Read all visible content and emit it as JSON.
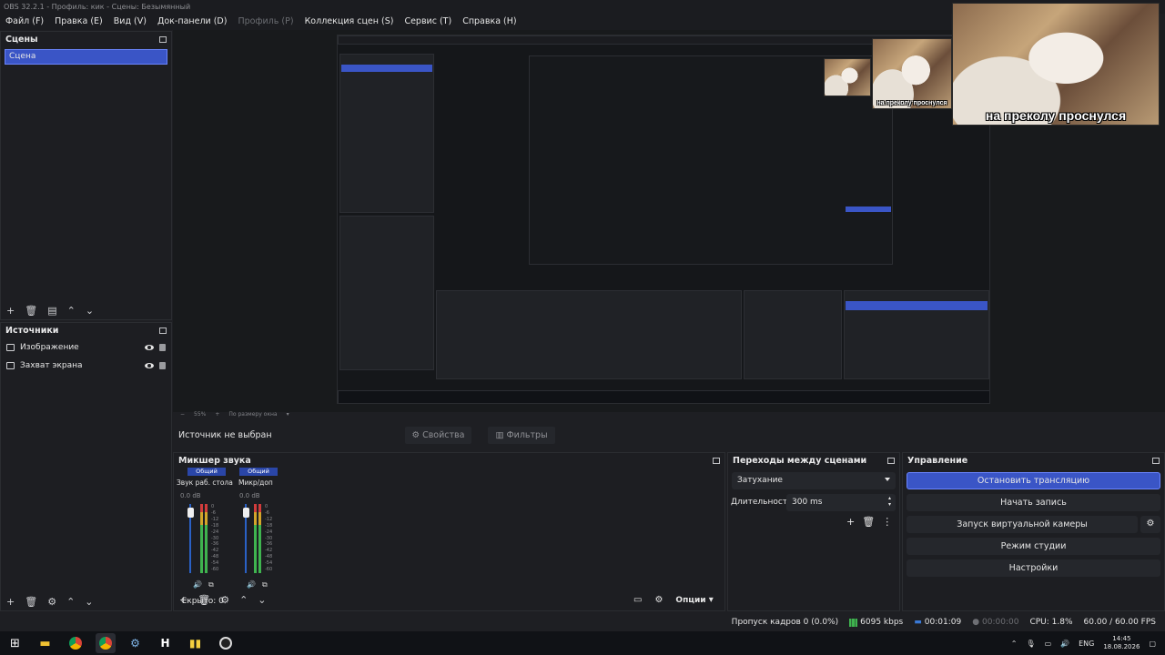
{
  "window": {
    "title": "OBS 32.2.1 - Профиль: кик - Сцены: Безымянный"
  },
  "menu": [
    {
      "label": "Файл (F)",
      "enabled": true
    },
    {
      "label": "Правка (E)",
      "enabled": true
    },
    {
      "label": "Вид (V)",
      "enabled": true
    },
    {
      "label": "Док-панели (D)",
      "enabled": true
    },
    {
      "label": "Профиль (P)",
      "enabled": false
    },
    {
      "label": "Коллекция сцен (S)",
      "enabled": true
    },
    {
      "label": "Сервис (T)",
      "enabled": true
    },
    {
      "label": "Справка (H)",
      "enabled": true
    }
  ],
  "scenes": {
    "title": "Сцены",
    "items": [
      "Сцена"
    ]
  },
  "sources": {
    "title": "Источники",
    "items": [
      {
        "label": "Изображение",
        "icon": "image-icon"
      },
      {
        "label": "Захват экрана",
        "icon": "monitor-icon"
      }
    ]
  },
  "preview": {
    "overlay_caption_large": "на преколу проснулся",
    "overlay_caption_small": "на преколу проснулся",
    "zoom": "55%",
    "fit": "По размеру окна"
  },
  "context": {
    "no_source": "Источник не выбран",
    "properties": "Свойства",
    "filters": "Фильтры"
  },
  "mixer": {
    "title": "Микшер звука",
    "channels": [
      {
        "tag": "Общий",
        "name": "Звук раб. стола",
        "db": "0.0 dB"
      },
      {
        "tag": "Общий",
        "name": "Микр/доп",
        "db": "0.0 dB"
      }
    ],
    "scale": [
      "0",
      "-6",
      "-12",
      "-18",
      "-24",
      "-30",
      "-36",
      "-42",
      "-48",
      "-54",
      "-60"
    ],
    "hidden": "Скрыто: 0",
    "options": "Опции"
  },
  "transitions": {
    "title": "Переходы между сценами",
    "selected": "Затухание",
    "duration_label": "Длительность",
    "duration_value": "300 ms"
  },
  "controls": {
    "title": "Управление",
    "stop_stream": "Остановить трансляцию",
    "start_record": "Начать запись",
    "virtual_cam": "Запуск виртуальной камеры",
    "studio_mode": "Режим студии",
    "settings": "Настройки"
  },
  "status": {
    "dropped": "Пропуск кадров 0 (0.0%)",
    "bitrate": "6095 kbps",
    "stream_time": "00:01:09",
    "record_time": "00:00:00",
    "cpu": "CPU: 1.8%",
    "fps": "60.00 / 60.00 FPS"
  },
  "taskbar": {
    "language": "ENG",
    "time": "14:45",
    "date": "18.08.2026"
  },
  "colors": {
    "accent": "#3a55c6",
    "panel": "#1d1e22",
    "meter_green": "#3fb44f",
    "meter_red": "#d13c3c"
  }
}
